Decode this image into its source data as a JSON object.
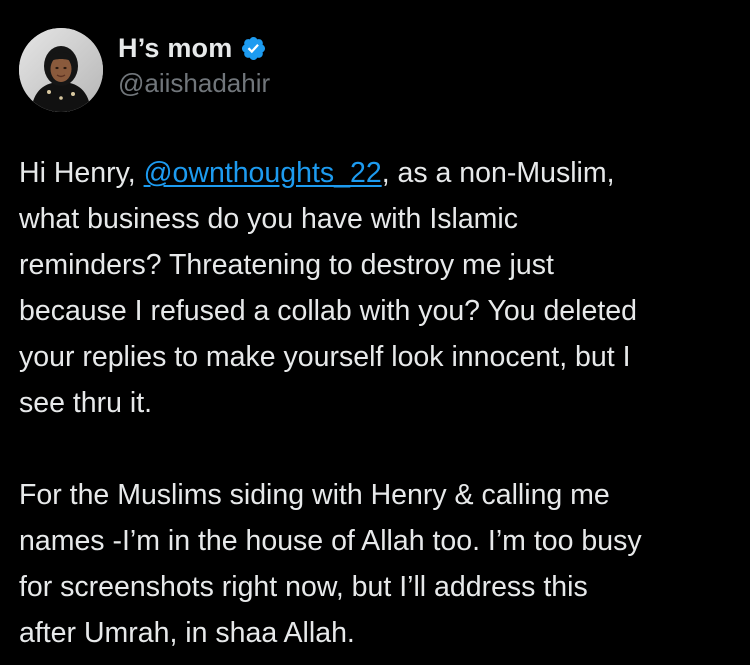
{
  "author": {
    "display_name": "H’s mom",
    "handle": "@aiishadahir",
    "verified": true,
    "avatar": "avatar-photo"
  },
  "tweet": {
    "para1": {
      "l1_pre": "Hi Henry, ",
      "l1_mention": "@ownthoughts_22",
      "l1_post": ", as a non-Muslim,",
      "l2": "what business do you have with Islamic",
      "l3": "reminders? Threatening to destroy me just",
      "l4": "because I refused a collab with you? You deleted",
      "l5": "your replies to make yourself look innocent, but I",
      "l6": "see thru it."
    },
    "para2": {
      "l1": "For the Muslims siding with Henry & calling me",
      "l2": "names -I’m in the house of Allah too. I’m too busy",
      "l3": "for screenshots right now, but I’ll address this",
      "l4": "after Umrah, in shaa Allah."
    }
  },
  "colors": {
    "background": "#000000",
    "text": "#e7e9ea",
    "handle": "#71767b",
    "link": "#1d9bf0",
    "verified_badge": "#1d9bf0"
  },
  "icons": {
    "verified": "verified-badge-icon"
  }
}
